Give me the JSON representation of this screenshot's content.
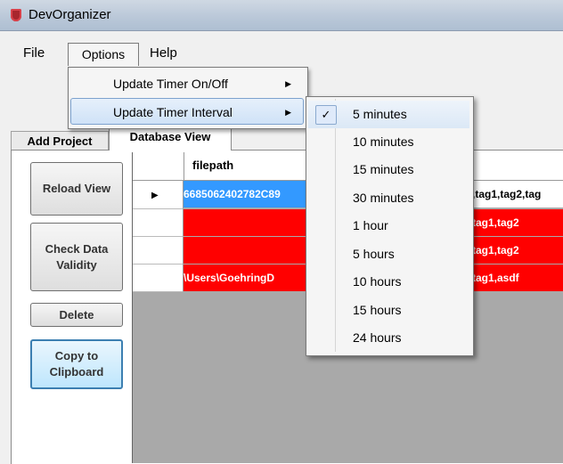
{
  "window": {
    "title": "DevOrganizer"
  },
  "menubar": {
    "file": "File",
    "options": "Options",
    "help": "Help"
  },
  "options_menu": {
    "items": [
      {
        "label": "Update Timer On/Off",
        "submenu_arrow": "▶"
      },
      {
        "label": "Update Timer Interval",
        "submenu_arrow": "▶"
      }
    ]
  },
  "interval_menu": {
    "checkmark": "✓",
    "items": [
      "5 minutes",
      "10 minutes",
      "15 minutes",
      "30 minutes",
      "1 hour",
      "5 hours",
      "10 hours",
      "15 hours",
      "24 hours"
    ],
    "selected_index": 0
  },
  "tabs": {
    "add_project": "Add Project",
    "database_view": "Database View"
  },
  "buttons": {
    "reload": "Reload View",
    "check": "Check Data Validity",
    "delete": "Delete",
    "copy": "Copy to Clipboard"
  },
  "grid": {
    "columns": {
      "filepath": "filepath",
      "tags": "s"
    },
    "rows": [
      {
        "filepath": "6685062402782C89",
        "tags": ",tag1,tag2,tag"
      },
      {
        "filepath": "",
        "tags": "tag1,tag2"
      },
      {
        "filepath": "",
        "tags": "tag1,tag2"
      },
      {
        "filepath": "\\Users\\GoehringD",
        "tags": "tag1,asdf"
      }
    ],
    "current_row_marker": "▶"
  },
  "colors": {
    "invalid_row": "#ff0000",
    "selected_cell": "#3399ff"
  }
}
